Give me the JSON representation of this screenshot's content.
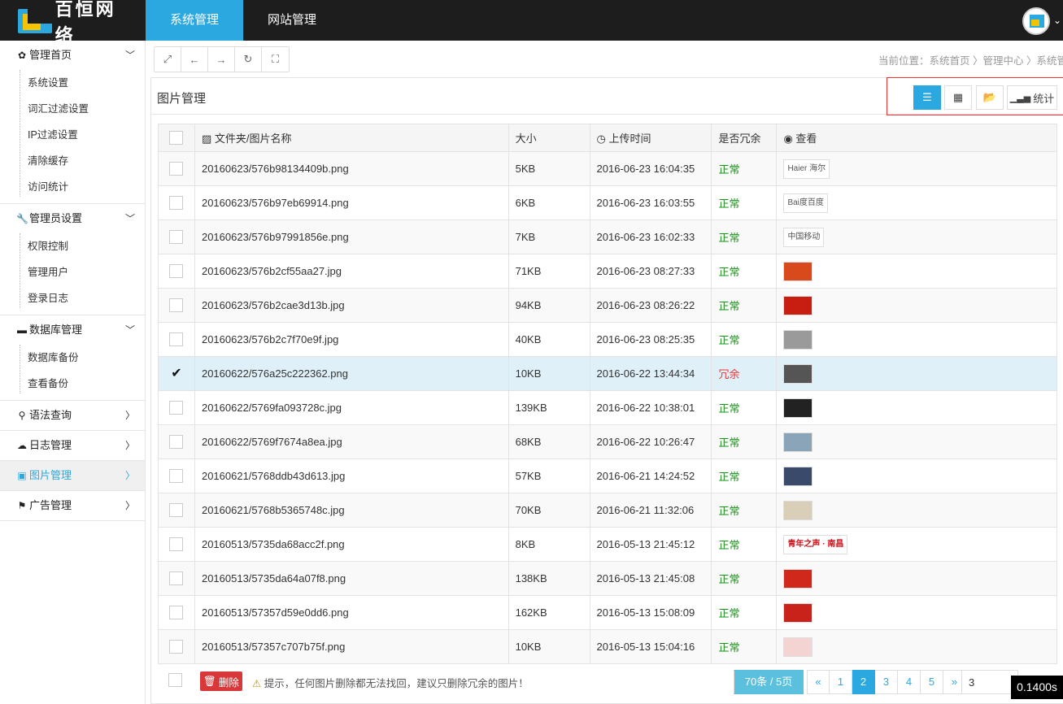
{
  "brand": {
    "name": "百恒网络"
  },
  "topnav": [
    {
      "label": "系统管理",
      "active": true
    },
    {
      "label": "网站管理",
      "active": false
    }
  ],
  "sidebar": {
    "groups": [
      {
        "label": "管理首页",
        "icon": "gear-icon",
        "expanded": true,
        "items": [
          "系统设置",
          "词汇过滤设置",
          "IP过滤设置",
          "清除缓存",
          "访问统计"
        ]
      },
      {
        "label": "管理员设置",
        "icon": "wrench-icon",
        "expanded": true,
        "items": [
          "权限控制",
          "管理用户",
          "登录日志"
        ]
      },
      {
        "label": "数据库管理",
        "icon": "database-icon",
        "expanded": true,
        "items": [
          "数据库备份",
          "查看备份"
        ]
      },
      {
        "label": "语法查询",
        "icon": "search-icon",
        "expanded": false,
        "items": []
      },
      {
        "label": "日志管理",
        "icon": "cloud-icon",
        "expanded": false,
        "items": []
      },
      {
        "label": "图片管理",
        "icon": "picture-icon",
        "expanded": false,
        "active": true,
        "items": []
      },
      {
        "label": "广告管理",
        "icon": "flag-icon",
        "expanded": false,
        "items": []
      }
    ]
  },
  "breadcrumb": "当前位置：系统首页 〉管理中心 〉系统管理",
  "panel": {
    "title": "图片管理",
    "stats_label": "统计"
  },
  "table": {
    "headers": {
      "name": "文件夹/图片名称",
      "size": "大小",
      "time": "上传时间",
      "redundant": "是否冗余",
      "view": "查看"
    },
    "rows": [
      {
        "name": "20160623/576b98134409b.png",
        "size": "5KB",
        "time": "2016-06-23 16:04:35",
        "status": "正常",
        "checked": false,
        "thumb": "Haier 海尔",
        "thumb_color": "#ffffff"
      },
      {
        "name": "20160623/576b97eb69914.png",
        "size": "6KB",
        "time": "2016-06-23 16:03:55",
        "status": "正常",
        "checked": false,
        "thumb": "Bai度百度",
        "thumb_color": "#ffffff"
      },
      {
        "name": "20160623/576b97991856e.png",
        "size": "7KB",
        "time": "2016-06-23 16:02:33",
        "status": "正常",
        "checked": false,
        "thumb": "中国移动",
        "thumb_color": "#ffffff"
      },
      {
        "name": "20160623/576b2cf55aa27.jpg",
        "size": "71KB",
        "time": "2016-06-23 08:27:33",
        "status": "正常",
        "checked": false,
        "thumb": "",
        "thumb_color": "#d84a1b"
      },
      {
        "name": "20160623/576b2cae3d13b.jpg",
        "size": "94KB",
        "time": "2016-06-23 08:26:22",
        "status": "正常",
        "checked": false,
        "thumb": "",
        "thumb_color": "#c81e12"
      },
      {
        "name": "20160623/576b2c7f70e9f.jpg",
        "size": "40KB",
        "time": "2016-06-23 08:25:35",
        "status": "正常",
        "checked": false,
        "thumb": "",
        "thumb_color": "#9a9a9a"
      },
      {
        "name": "20160622/576a25c222362.png",
        "size": "10KB",
        "time": "2016-06-22 13:44:34",
        "status": "冗余",
        "checked": true,
        "thumb": "",
        "thumb_color": "#555555"
      },
      {
        "name": "20160622/5769fa093728c.jpg",
        "size": "139KB",
        "time": "2016-06-22 10:38:01",
        "status": "正常",
        "checked": false,
        "thumb": "",
        "thumb_color": "#222222"
      },
      {
        "name": "20160622/5769f7674a8ea.jpg",
        "size": "68KB",
        "time": "2016-06-22 10:26:47",
        "status": "正常",
        "checked": false,
        "thumb": "",
        "thumb_color": "#8aa5b8"
      },
      {
        "name": "20160621/5768ddb43d613.jpg",
        "size": "57KB",
        "time": "2016-06-21 14:24:52",
        "status": "正常",
        "checked": false,
        "thumb": "",
        "thumb_color": "#3a4a6a"
      },
      {
        "name": "20160621/5768b5365748c.jpg",
        "size": "70KB",
        "time": "2016-06-21 11:32:06",
        "status": "正常",
        "checked": false,
        "thumb": "",
        "thumb_color": "#d9cfb8"
      },
      {
        "name": "20160513/5735da68acc2f.png",
        "size": "8KB",
        "time": "2016-05-13 21:45:12",
        "status": "正常",
        "checked": false,
        "thumb": "青年之声 · 南昌",
        "thumb_color": "#ffffff"
      },
      {
        "name": "20160513/5735da64a07f8.png",
        "size": "138KB",
        "time": "2016-05-13 21:45:08",
        "status": "正常",
        "checked": false,
        "thumb": "",
        "thumb_color": "#d0281a"
      },
      {
        "name": "20160513/57357d59e0dd6.png",
        "size": "162KB",
        "time": "2016-05-13 15:08:09",
        "status": "正常",
        "checked": false,
        "thumb": "",
        "thumb_color": "#c8221a"
      },
      {
        "name": "20160513/57357c707b75f.png",
        "size": "10KB",
        "time": "2016-05-13 15:04:16",
        "status": "正常",
        "checked": false,
        "thumb": "",
        "thumb_color": "#f4d3d3"
      }
    ]
  },
  "footer": {
    "delete_label": "删除",
    "tip": "提示，任何图片删除都无法找回，建议只删除冗余的图片！"
  },
  "pagination": {
    "total": "70条 / 5页",
    "prev": "«",
    "pages": [
      "1",
      "2",
      "3",
      "4",
      "5"
    ],
    "current": "2",
    "next": "»",
    "jump_value": "3"
  },
  "timer": "0.1400s",
  "colors": {
    "accent": "#2ba8e0",
    "topbar": "#1d1d1d",
    "ok": "#1a8f1a",
    "danger": "#e33333"
  }
}
